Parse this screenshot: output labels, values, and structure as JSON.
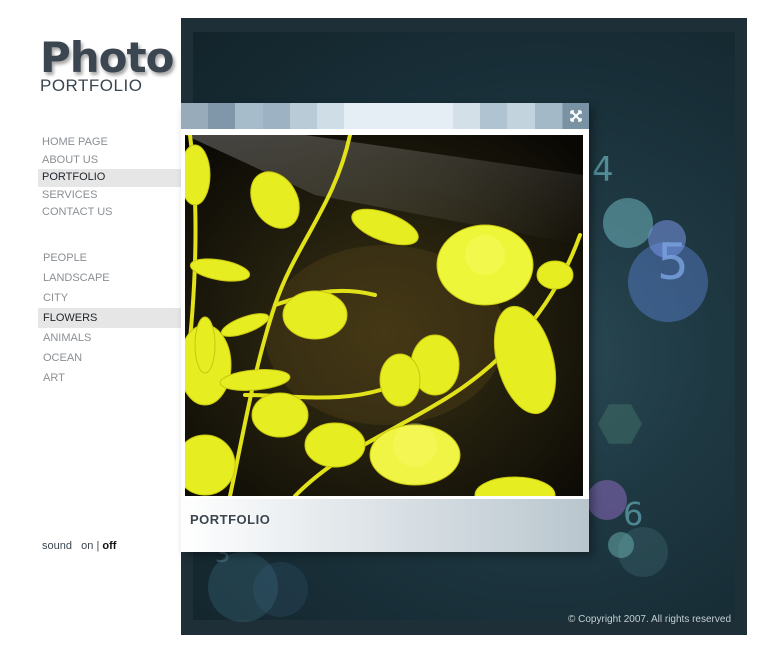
{
  "logo": {
    "title": "Photo",
    "subtitle": "PORTFOLIO"
  },
  "menu": [
    {
      "label": "HOME PAGE",
      "active": false
    },
    {
      "label": "ABOUT US",
      "active": false
    },
    {
      "label": "PORTFOLIO",
      "active": true
    },
    {
      "label": "SERVICES",
      "active": false
    },
    {
      "label": "CONTACT US",
      "active": false
    }
  ],
  "categories": [
    {
      "label": "PEOPLE",
      "active": false
    },
    {
      "label": "LANDSCAPE",
      "active": false
    },
    {
      "label": "CITY",
      "active": false
    },
    {
      "label": "FLOWERS",
      "active": true
    },
    {
      "label": "ANIMALS",
      "active": false
    },
    {
      "label": "OCEAN",
      "active": false
    },
    {
      "label": "ART",
      "active": false
    }
  ],
  "sound": {
    "label": "sound",
    "on": "on",
    "separator": "|",
    "off": "off"
  },
  "stage": {
    "numbers": [
      "4",
      "5",
      "6",
      "3"
    ]
  },
  "popup": {
    "footer_label": "PORTFOLIO",
    "close_icon": "close-icon",
    "titlebar_colors": [
      "#97abbb",
      "#7f97a9",
      "#a7bccb",
      "#9db3c3",
      "#b9cbd7",
      "#cfdde6",
      "#e4eef4",
      "#e4eef4",
      "#e4eef4",
      "#e4eef4",
      "#d3e0e8",
      "#b0c3d0",
      "#c3d3dd",
      "#a4b9c8",
      "#8ca3b5"
    ]
  },
  "copyright": "© Copyright 2007. All rights reserved",
  "colors": {
    "accent": "#3b4650",
    "stage": "#1f2f37",
    "highlight": "#e6e6e6"
  }
}
